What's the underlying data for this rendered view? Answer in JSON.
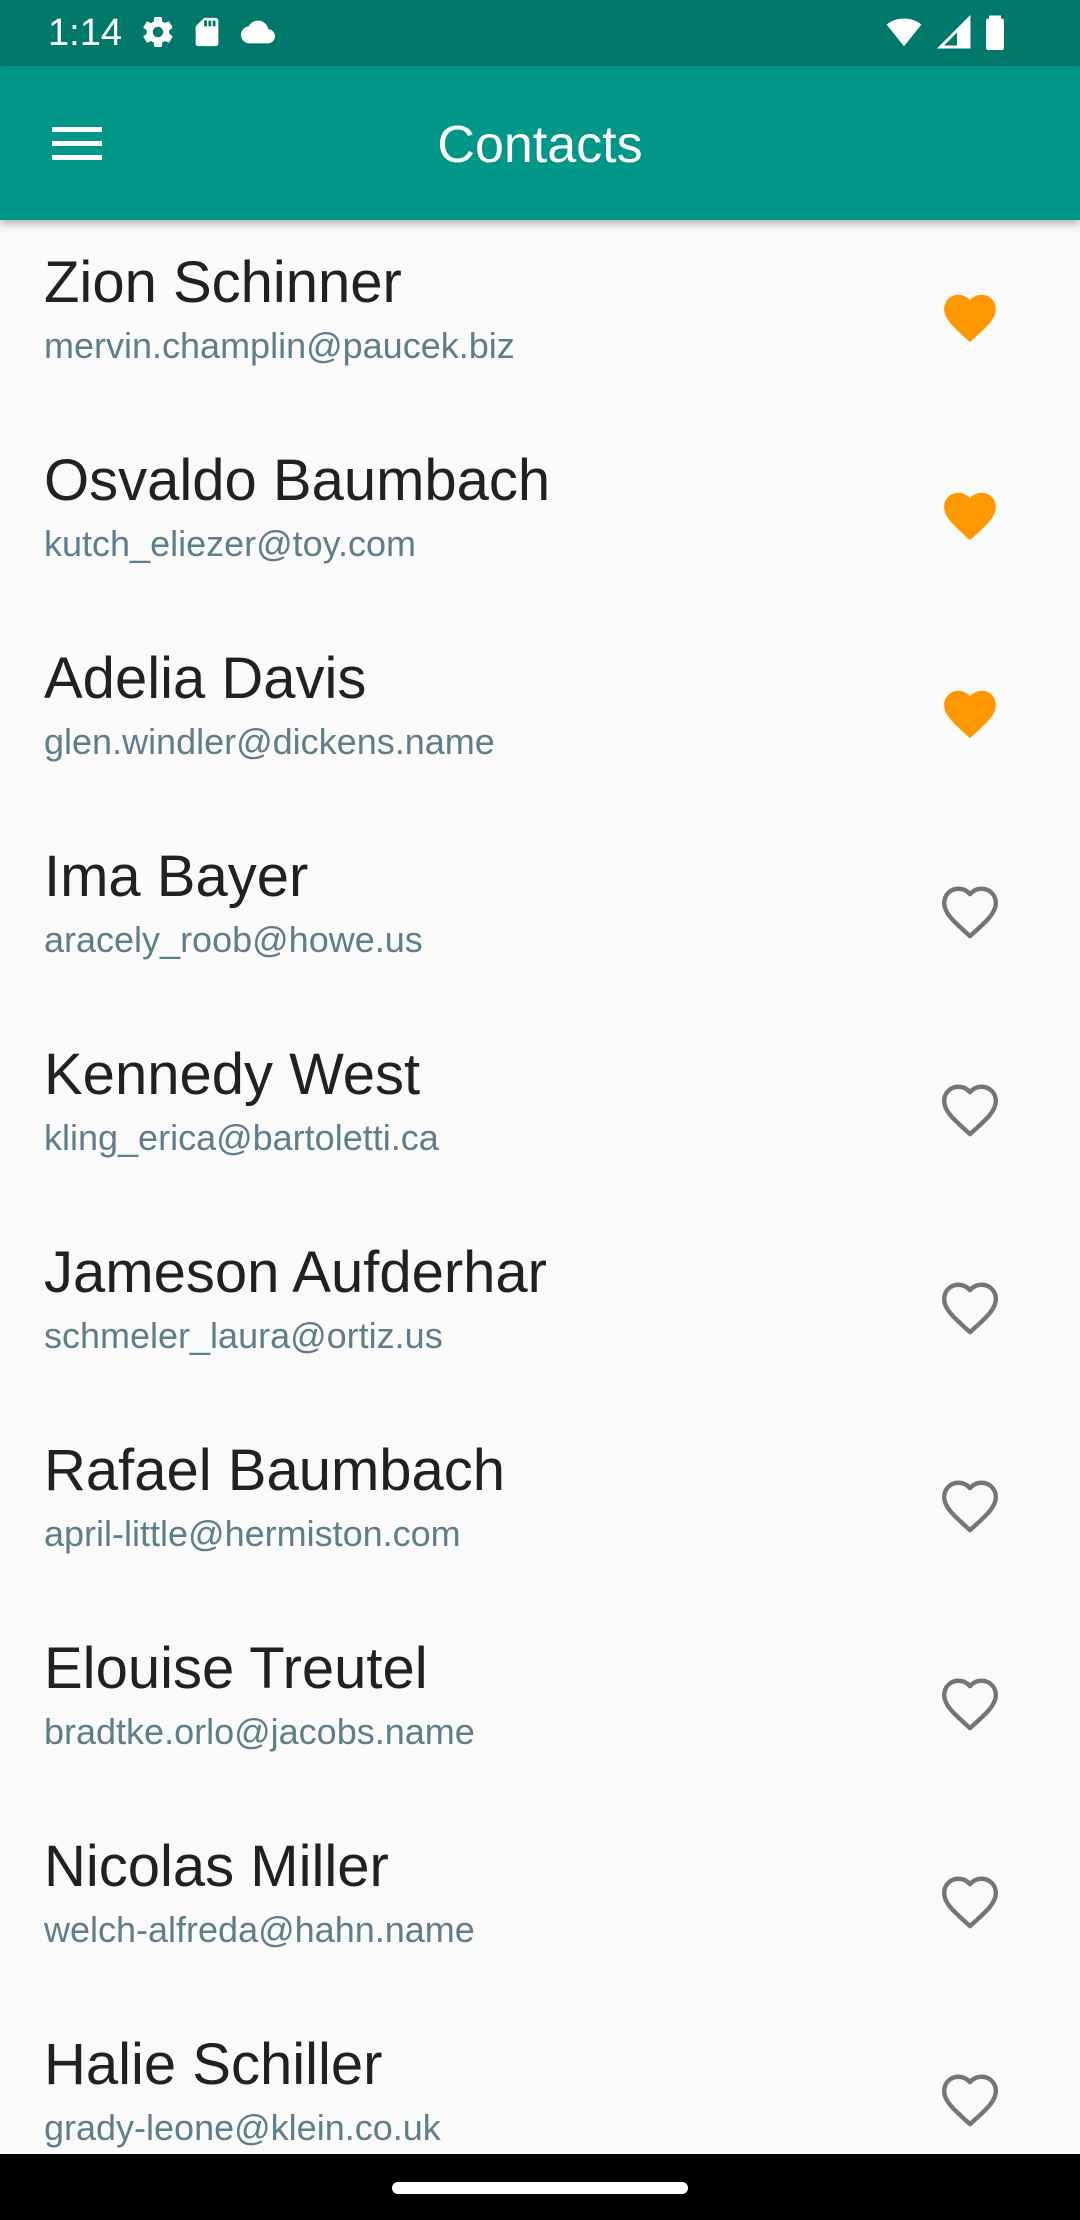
{
  "status_bar": {
    "time": "1:14",
    "left_icons": [
      "settings-icon",
      "sd-card-icon",
      "cloud-icon"
    ],
    "right_icons": [
      "wifi-icon",
      "signal-icon",
      "battery-icon"
    ]
  },
  "app_bar": {
    "title": "Contacts",
    "menu_icon": "menu-icon"
  },
  "colors": {
    "status_bar": "#00796b",
    "app_bar": "#009688",
    "favorite": "#ff9800",
    "not_favorite": "#757575",
    "name_text": "#212121",
    "email_text": "#607d8b",
    "background": "#fafafa"
  },
  "contacts": [
    {
      "name": "Zion Schinner",
      "email": "mervin.champlin@paucek.biz",
      "favorite": true
    },
    {
      "name": "Osvaldo Baumbach",
      "email": "kutch_eliezer@toy.com",
      "favorite": true
    },
    {
      "name": "Adelia Davis",
      "email": "glen.windler@dickens.name",
      "favorite": true
    },
    {
      "name": "Ima Bayer",
      "email": "aracely_roob@howe.us",
      "favorite": false
    },
    {
      "name": "Kennedy West",
      "email": "kling_erica@bartoletti.ca",
      "favorite": false
    },
    {
      "name": "Jameson Aufderhar",
      "email": "schmeler_laura@ortiz.us",
      "favorite": false
    },
    {
      "name": "Rafael Baumbach",
      "email": "april-little@hermiston.com",
      "favorite": false
    },
    {
      "name": "Elouise Treutel",
      "email": "bradtke.orlo@jacobs.name",
      "favorite": false
    },
    {
      "name": "Nicolas Miller",
      "email": "welch-alfreda@hahn.name",
      "favorite": false
    },
    {
      "name": "Halie Schiller",
      "email": "grady-leone@klein.co.uk",
      "favorite": false
    }
  ]
}
